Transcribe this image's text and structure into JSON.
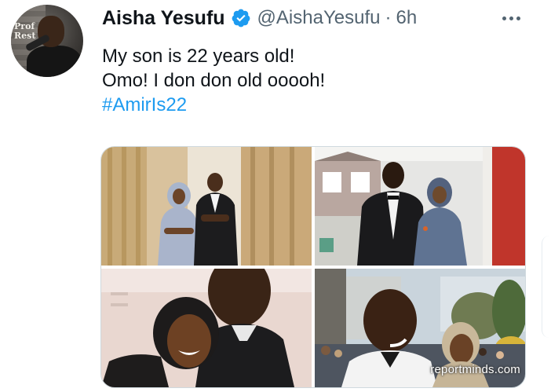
{
  "tweet": {
    "author_name": "Aisha Yesufu",
    "handle": "@AishaYesufu",
    "separator": "·",
    "time": "6h",
    "avatar_text": "Prof\nRest",
    "lines": [
      "My son is 22 years old!",
      "Omo! I don don old ooooh!"
    ],
    "hashtag": "#AmirIs22"
  },
  "media": {
    "watermark": "reportminds.com"
  },
  "colors": {
    "verified": "#1d9bf0",
    "hashtag": "#1d9bf0",
    "secondary_text": "#536471",
    "border": "#cfd9de"
  },
  "icons": {
    "verified": "verified-badge-icon",
    "more": "more-options-icon"
  }
}
